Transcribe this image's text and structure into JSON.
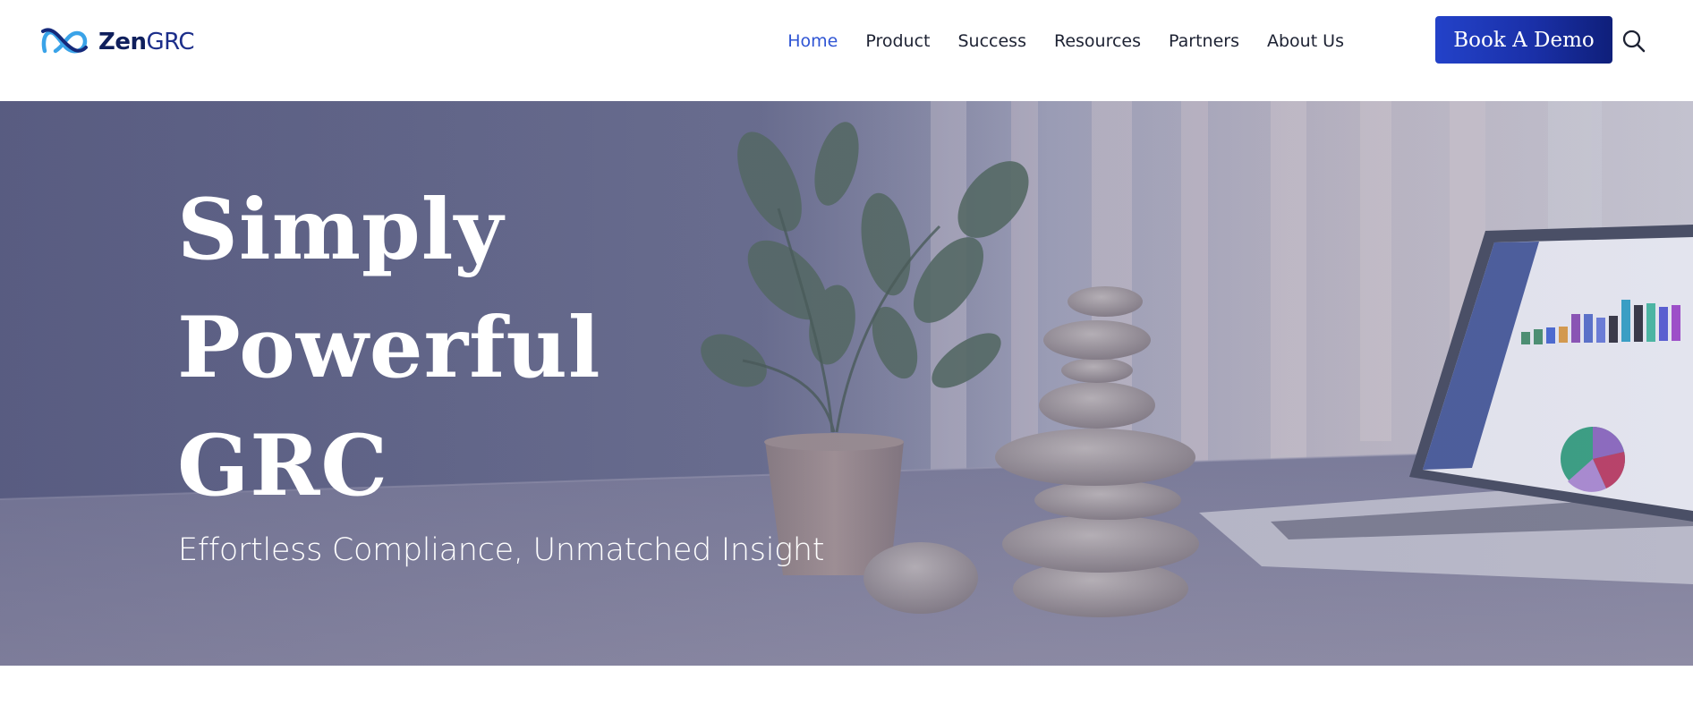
{
  "brand": {
    "name_bold": "Zen",
    "name_regular": "GRC",
    "logo_icon": "infinity-logo-icon",
    "colors": {
      "navy": "#14216b",
      "accent": "#2f55d4",
      "logo_light": "#3aa3e8"
    }
  },
  "nav": {
    "items": [
      {
        "label": "Home",
        "active": true
      },
      {
        "label": "Product",
        "active": false
      },
      {
        "label": "Success",
        "active": false
      },
      {
        "label": "Resources",
        "active": false
      },
      {
        "label": "Partners",
        "active": false
      },
      {
        "label": "About Us",
        "active": false
      }
    ],
    "cta_label": "Book A Demo",
    "cta_color": "#1a30a8",
    "search_icon": "search-icon"
  },
  "hero": {
    "title_lines": [
      "Simply",
      "Powerful",
      "GRC"
    ],
    "subtitle": "Effortless Compliance, Unmatched Insight",
    "overlay_color": "#5e6184"
  }
}
